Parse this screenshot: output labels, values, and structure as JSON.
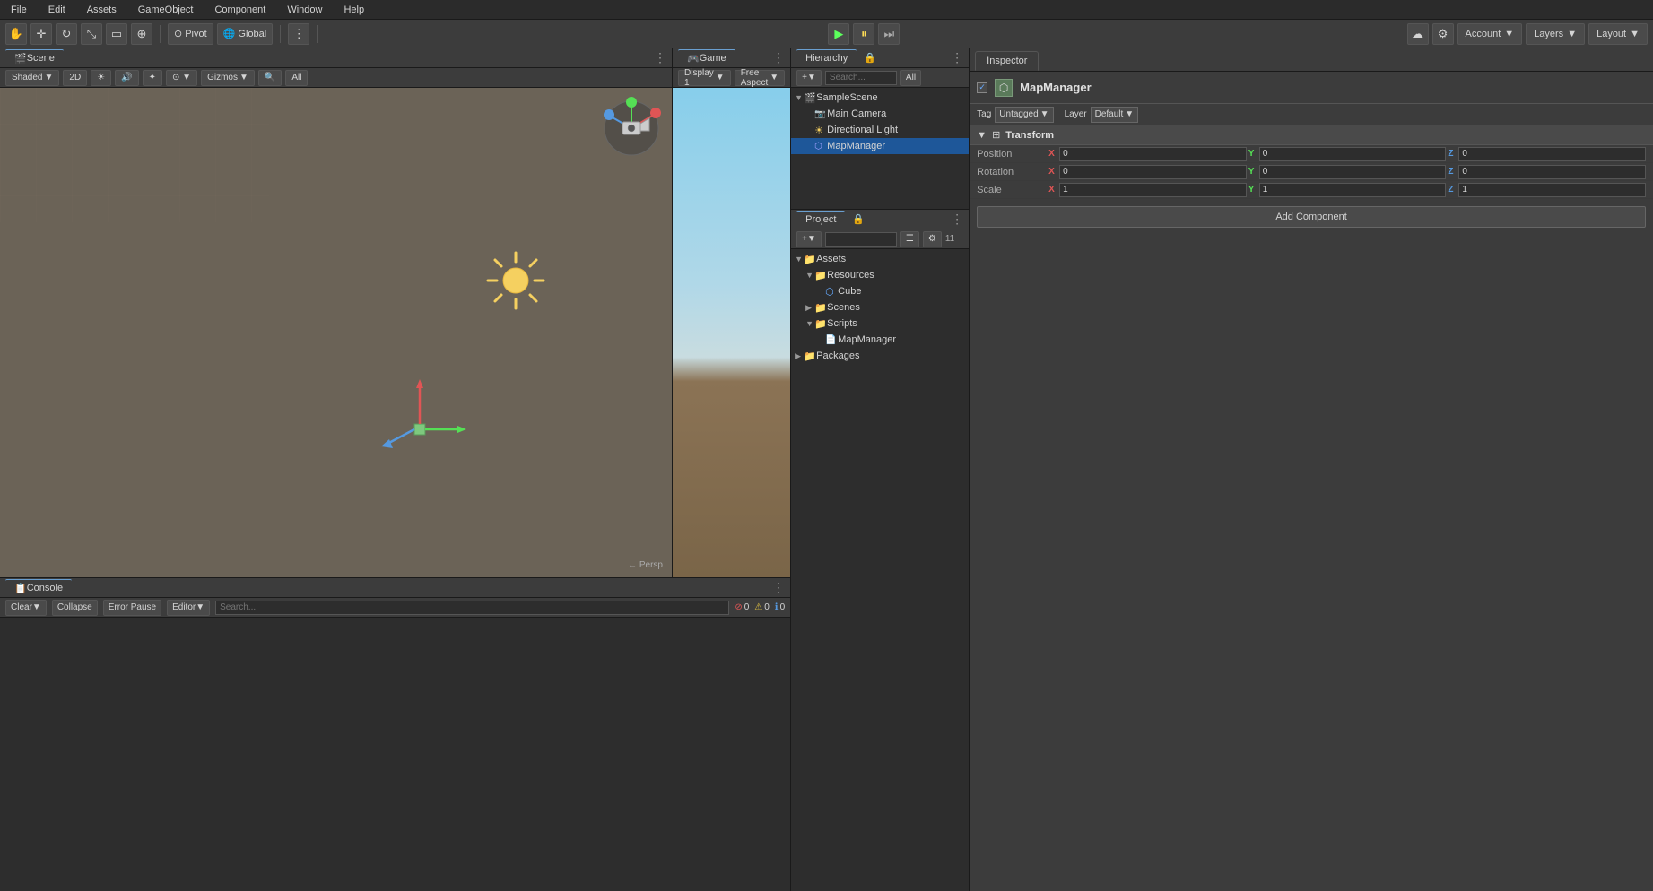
{
  "menubar": {
    "items": [
      "File",
      "Edit",
      "Assets",
      "GameObject",
      "Component",
      "Window",
      "Help"
    ]
  },
  "toolbar": {
    "transform_tools": [
      "hand",
      "move",
      "rotate",
      "scale",
      "rect",
      "transform"
    ],
    "pivot_label": "Pivot",
    "global_label": "Global",
    "play_icon": "▶",
    "pause_icon": "⏸",
    "step_icon": "⏭",
    "account_label": "Account",
    "layers_label": "Layers",
    "layout_label": "Layout"
  },
  "scene": {
    "tab_label": "Scene",
    "shading_mode": "Shaded",
    "is_2d": "2D",
    "gizmos_label": "Gizmos",
    "all_label": "All",
    "persp_label": "← Persp"
  },
  "game": {
    "tab_label": "Game",
    "display_label": "Display 1",
    "aspect_label": "Free Aspect"
  },
  "hierarchy": {
    "tab_label": "Hierarchy",
    "search_placeholder": "Search...",
    "items": [
      {
        "name": "SampleScene",
        "level": 0,
        "has_arrow": true,
        "icon": "scene"
      },
      {
        "name": "Main Camera",
        "level": 1,
        "has_arrow": false,
        "icon": "camera"
      },
      {
        "name": "Directional Light",
        "level": 1,
        "has_arrow": false,
        "icon": "light"
      },
      {
        "name": "MapManager",
        "level": 1,
        "has_arrow": false,
        "icon": "gameobj",
        "selected": true
      }
    ]
  },
  "project": {
    "tab_label": "Project",
    "search_placeholder": "",
    "items": [
      {
        "name": "Assets",
        "level": 0,
        "has_arrow": true,
        "icon": "folder"
      },
      {
        "name": "Resources",
        "level": 1,
        "has_arrow": true,
        "icon": "folder"
      },
      {
        "name": "Cube",
        "level": 2,
        "has_arrow": false,
        "icon": "cube"
      },
      {
        "name": "Scenes",
        "level": 1,
        "has_arrow": true,
        "icon": "folder"
      },
      {
        "name": "Scripts",
        "level": 1,
        "has_arrow": true,
        "icon": "folder"
      },
      {
        "name": "MapManager",
        "level": 2,
        "has_arrow": false,
        "icon": "script"
      },
      {
        "name": "Packages",
        "level": 0,
        "has_arrow": true,
        "icon": "folder"
      }
    ]
  },
  "inspector": {
    "tab_label": "Inspector",
    "object_name": "MapManager",
    "tag_label": "Tag",
    "tag_value": "Untagged",
    "layer_label": "Layer",
    "layer_value": "Default",
    "transform_label": "Transform",
    "position_label": "Position",
    "rotation_label": "Rotation",
    "scale_label": "Scale",
    "pos_x": "0",
    "pos_y": "0",
    "pos_z": "0",
    "rot_x": "0",
    "rot_y": "0",
    "rot_z": "0",
    "scale_x": "1",
    "scale_y": "1",
    "scale_z": "1",
    "add_component_label": "Add Component"
  },
  "console": {
    "tab_label": "Console",
    "clear_label": "Clear",
    "collapse_label": "Collapse",
    "error_pause_label": "Error Pause",
    "editor_label": "Editor",
    "error_count": "0",
    "warning_count": "0",
    "info_count": "0"
  }
}
